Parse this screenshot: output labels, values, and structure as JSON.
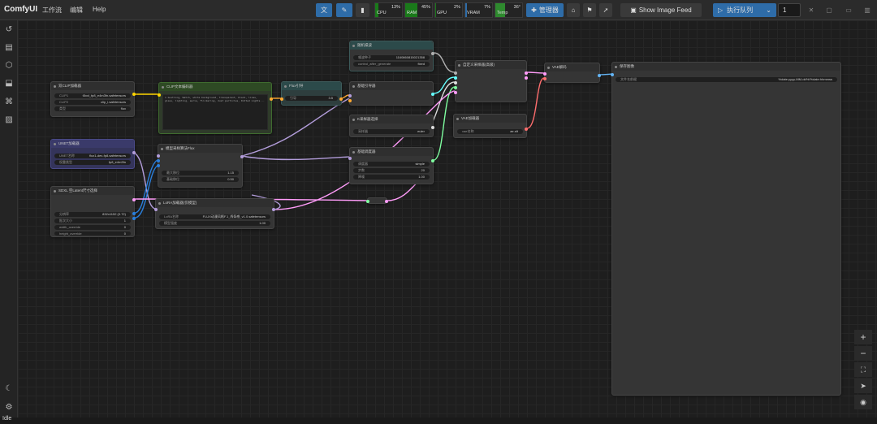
{
  "app": {
    "logo": "ComfyUI",
    "menus": [
      "工作流",
      "编辑",
      "Help"
    ]
  },
  "toolbar": {
    "monitors": [
      {
        "label": "CPU",
        "pct": "13%",
        "level": 13,
        "color": "#1a7a1a"
      },
      {
        "label": "RAM",
        "pct": "45%",
        "level": 45,
        "color": "#1a7a1a"
      },
      {
        "label": "GPU",
        "pct": "2%",
        "level": 2,
        "color": "#1a7a1a"
      },
      {
        "label": "VRAM",
        "pct": "7%",
        "level": 7,
        "color": "#2e6ca8"
      },
      {
        "label": "Temp",
        "pct": "36°",
        "level": 36,
        "color": "#2e8a2e"
      }
    ],
    "manager_label": "管理器",
    "image_feed_label": "Show Image Feed",
    "queue_label": "执行队列",
    "queue_count": "1"
  },
  "status": {
    "idle": "Idle"
  },
  "nodes": {
    "dual_clip": {
      "title": "双CLIP加载器",
      "w": [
        [
          "CLIP1",
          "t5xxl_fp8_e4m3fn.safetensors"
        ],
        [
          "CLIP2",
          "clip_l.safetensors"
        ],
        [
          "类型",
          "flux"
        ]
      ]
    },
    "clip_text": {
      "title": "CLIP文本编码器",
      "text": "1 bustling, Watch, white background, transparent, black, lines, glass, lighting, eerie, flickering, dust particles, Dotted Lights..."
    },
    "flux_guidance": {
      "title": "Flux引导",
      "w": [
        [
          "引导",
          "3.5"
        ]
      ]
    },
    "random_noise": {
      "title": "随机噪波",
      "w": [
        [
          "噪波种子",
          "1160860815021358"
        ],
        [
          "control_after_generate",
          "fixed"
        ]
      ]
    },
    "basic_guider": {
      "title": "基础引导器"
    },
    "ksampler_select": {
      "title": "K采样器选择",
      "w": [
        [
          "采样器",
          "euler"
        ]
      ]
    },
    "basic_scheduler": {
      "title": "基础调度器",
      "w": [
        [
          "调度器",
          "simple"
        ],
        [
          "步数",
          "20"
        ],
        [
          "降噪",
          "1.00"
        ]
      ]
    },
    "custom_sampler": {
      "title": "自定义采样器(高级)"
    },
    "vae_loader": {
      "title": "VAE加载器",
      "w": [
        [
          "vae名称",
          "ae.sft"
        ]
      ]
    },
    "vae_decode": {
      "title": "VAE解码"
    },
    "save_image": {
      "title": "保存图像",
      "w": [
        [
          "文件名前缀",
          "%date:yyyy-MM-dd%/%date:hhmmss"
        ]
      ]
    },
    "unet_loader": {
      "title": "UNET加载器",
      "w": [
        [
          "UNET名称",
          "flux1-dev-fp8.safetensors"
        ],
        [
          "权重类型",
          "fp8_e4m3fn"
        ]
      ]
    },
    "model_sampling": {
      "title": "模型采样算法Flux",
      "w": [
        [
          "最大移位",
          "1.15"
        ],
        [
          "基础移位",
          "0.50"
        ]
      ]
    },
    "latent_size": {
      "title": "SDXL 空Latent尺寸选择",
      "w": [
        [
          "分辨率",
          "832x1152 (0.72)"
        ],
        [
          "批次大小",
          "1"
        ],
        [
          "width_override",
          "0"
        ],
        [
          "height_override",
          "0"
        ]
      ]
    },
    "lora_loader": {
      "title": "LoRA加载器(仅模型)",
      "w": [
        [
          "LoRA名称",
          "FLUX动漫风格F.1_线条感_v1.0.safetensors"
        ],
        [
          "模型强度",
          "1.00"
        ]
      ]
    }
  }
}
